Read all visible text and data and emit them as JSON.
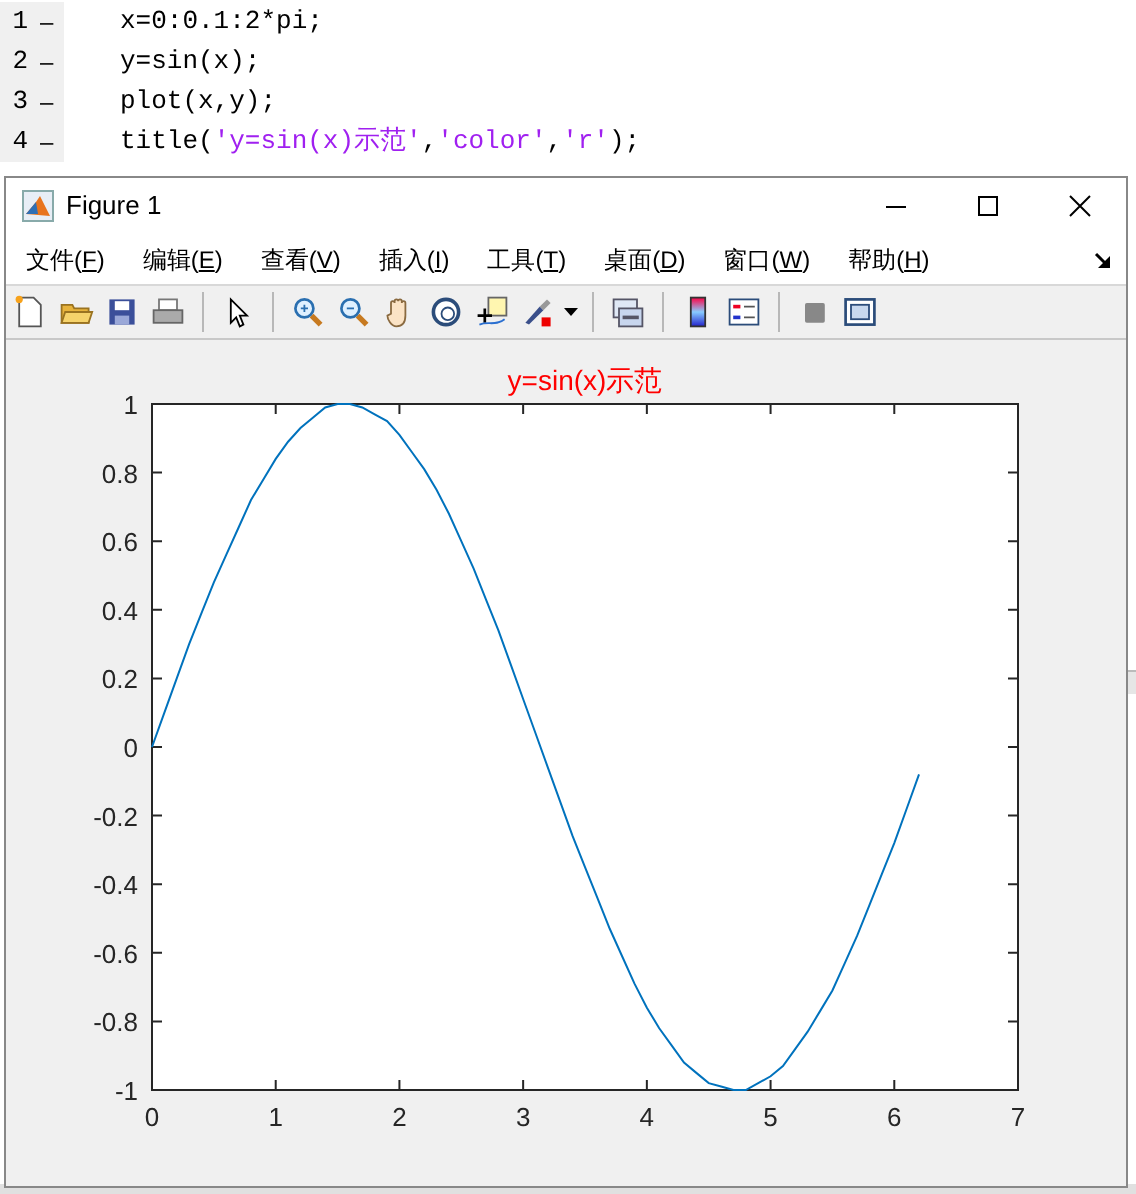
{
  "editor": {
    "lines": [
      {
        "number": "1",
        "marker": "–",
        "segments": [
          {
            "kind": "plain",
            "text": "x=0:0.1:2*pi;"
          }
        ]
      },
      {
        "number": "2",
        "marker": "–",
        "segments": [
          {
            "kind": "plain",
            "text": "y=sin(x);"
          }
        ]
      },
      {
        "number": "3",
        "marker": "–",
        "segments": [
          {
            "kind": "plain",
            "text": "plot(x,y);"
          }
        ]
      },
      {
        "number": "4",
        "marker": "–",
        "segments": [
          {
            "kind": "plain",
            "text": "title("
          },
          {
            "kind": "string",
            "text": "'y=sin(x)示范'"
          },
          {
            "kind": "plain",
            "text": ","
          },
          {
            "kind": "string",
            "text": "'color'"
          },
          {
            "kind": "plain",
            "text": ","
          },
          {
            "kind": "string",
            "text": "'r'"
          },
          {
            "kind": "plain",
            "text": ");"
          }
        ]
      }
    ]
  },
  "figure_window": {
    "title": "Figure 1",
    "menu": [
      {
        "pre": "文件(",
        "key": "F",
        "post": ")"
      },
      {
        "pre": "编辑(",
        "key": "E",
        "post": ")"
      },
      {
        "pre": "查看(",
        "key": "V",
        "post": ")"
      },
      {
        "pre": "插入(",
        "key": "I",
        "post": ")"
      },
      {
        "pre": "工具(",
        "key": "T",
        "post": ")"
      },
      {
        "pre": "桌面(",
        "key": "D",
        "post": ")"
      },
      {
        "pre": "窗口(",
        "key": "W",
        "post": ")"
      },
      {
        "pre": "帮助(",
        "key": "H",
        "post": ")"
      }
    ],
    "toolbar": [
      {
        "kind": "new"
      },
      {
        "kind": "open"
      },
      {
        "kind": "save"
      },
      {
        "kind": "print"
      },
      {
        "kind": "sep"
      },
      {
        "kind": "pointer"
      },
      {
        "kind": "sep"
      },
      {
        "kind": "zoomin"
      },
      {
        "kind": "zoomout"
      },
      {
        "kind": "pan"
      },
      {
        "kind": "rotate"
      },
      {
        "kind": "cursor"
      },
      {
        "kind": "brush"
      },
      {
        "kind": "sep"
      },
      {
        "kind": "link"
      },
      {
        "kind": "sep"
      },
      {
        "kind": "colorbar"
      },
      {
        "kind": "legend"
      },
      {
        "kind": "sep"
      },
      {
        "kind": "hide"
      },
      {
        "kind": "panel"
      }
    ],
    "chart_data": {
      "type": "line",
      "title": "y=sin(x)示范",
      "xlim": [
        0,
        7
      ],
      "ylim": [
        -1,
        1
      ],
      "xticks": [
        0,
        1,
        2,
        3,
        4,
        5,
        6,
        7
      ],
      "yticks": [
        -1,
        -0.8,
        -0.6,
        -0.4,
        -0.2,
        0,
        0.2,
        0.4,
        0.6,
        0.8,
        1
      ],
      "x": [
        0,
        0.1,
        0.2,
        0.3,
        0.4,
        0.5,
        0.6,
        0.7,
        0.8,
        0.9,
        1,
        1.1,
        1.2,
        1.3,
        1.4,
        1.5,
        1.6,
        1.7,
        1.8,
        1.9,
        2,
        2.1,
        2.2,
        2.3,
        2.4,
        2.5,
        2.6,
        2.7,
        2.8,
        2.9,
        3,
        3.1,
        3.2,
        3.3,
        3.4,
        3.5,
        3.6,
        3.7,
        3.8,
        3.9,
        4,
        4.1,
        4.2,
        4.3,
        4.4,
        4.5,
        4.6,
        4.7,
        4.8,
        4.9,
        5,
        5.1,
        5.2,
        5.3,
        5.4,
        5.5,
        5.6,
        5.7,
        5.8,
        5.9,
        6,
        6.1,
        6.2
      ],
      "series": [
        {
          "color": "#0072bd",
          "values": [
            0,
            0.1,
            0.2,
            0.3,
            0.39,
            0.48,
            0.56,
            0.64,
            0.72,
            0.78,
            0.84,
            0.89,
            0.93,
            0.96,
            0.99,
            1,
            1,
            0.99,
            0.97,
            0.95,
            0.91,
            0.86,
            0.81,
            0.75,
            0.68,
            0.6,
            0.52,
            0.43,
            0.34,
            0.24,
            0.14,
            0.04,
            -0.06,
            -0.16,
            -0.26,
            -0.35,
            -0.44,
            -0.53,
            -0.61,
            -0.69,
            -0.76,
            -0.82,
            -0.87,
            -0.92,
            -0.95,
            -0.98,
            -0.99,
            -1,
            -1,
            -0.98,
            -0.96,
            -0.93,
            -0.88,
            -0.83,
            -0.77,
            -0.71,
            -0.63,
            -0.55,
            -0.46,
            -0.37,
            -0.28,
            -0.18,
            -0.08
          ]
        }
      ]
    }
  }
}
